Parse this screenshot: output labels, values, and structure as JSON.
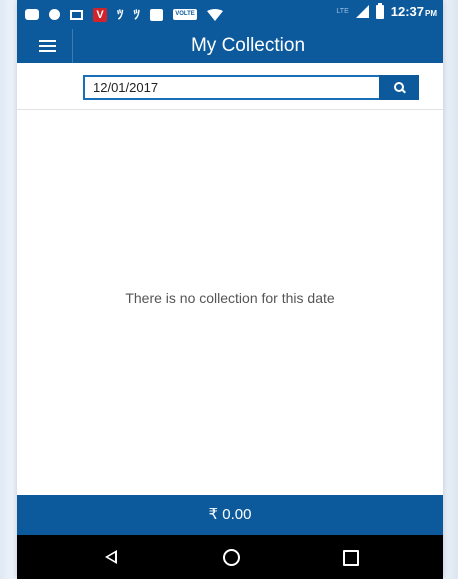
{
  "status_bar": {
    "time": "12:37",
    "ampm": "PM",
    "volte_label": "VOLTE",
    "lte_label": "LTE",
    "icons": [
      "message-icon",
      "location-pin-icon",
      "screen-icon",
      "vivaldi-v-icon",
      "app-icon",
      "app-icon",
      "bag-icon",
      "volte-icon",
      "wifi-icon",
      "signal-icon",
      "battery-icon"
    ]
  },
  "app_bar": {
    "title": "My Collection",
    "menu_icon": "hamburger-menu-icon"
  },
  "search": {
    "date_value": "12/01/2017",
    "button_icon": "search-icon"
  },
  "main": {
    "empty_message": "There is no collection for this date"
  },
  "footer": {
    "total": "₹ 0.00"
  },
  "nav_bar": {
    "icons": [
      "back-icon",
      "home-icon",
      "recent-apps-icon"
    ]
  },
  "colors": {
    "primary": "#0c5a9c",
    "input_border": "#1a6db7",
    "nav_background": "#000000",
    "text_muted": "#555555"
  }
}
